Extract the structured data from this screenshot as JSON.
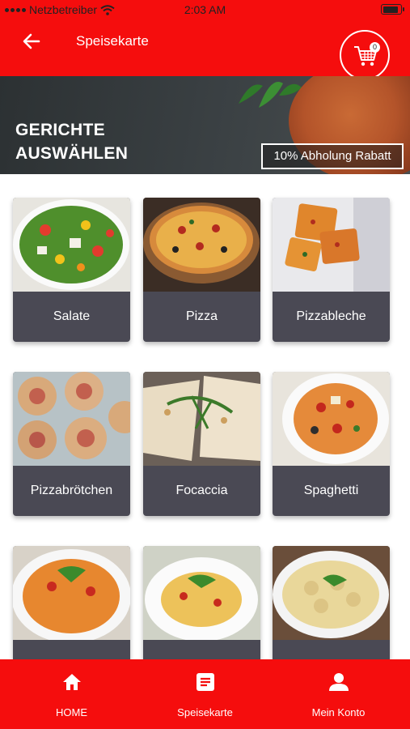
{
  "status_bar": {
    "carrier": "Netzbetreiber",
    "time": "2:03 AM"
  },
  "header": {
    "title": "Speisekarte",
    "cart_count": "0"
  },
  "banner": {
    "line1": "GERICHTE",
    "line2": "AUSWÄHLEN",
    "badge": "10% Abholung Rabatt"
  },
  "categories": [
    {
      "label": "Salate"
    },
    {
      "label": "Pizza"
    },
    {
      "label": "Pizzableche"
    },
    {
      "label": "Pizzabrötchen"
    },
    {
      "label": "Focaccia"
    },
    {
      "label": "Spaghetti"
    },
    {
      "label": ""
    },
    {
      "label": ""
    },
    {
      "label": ""
    }
  ],
  "bottom_nav": [
    {
      "label": "HOME",
      "icon": "home-icon"
    },
    {
      "label": "Speisekarte",
      "icon": "menu-book-icon"
    },
    {
      "label": "Mein Konto",
      "icon": "account-icon"
    }
  ],
  "colors": {
    "brand_red": "#f50d0d",
    "card_footer": "#4a4954"
  }
}
